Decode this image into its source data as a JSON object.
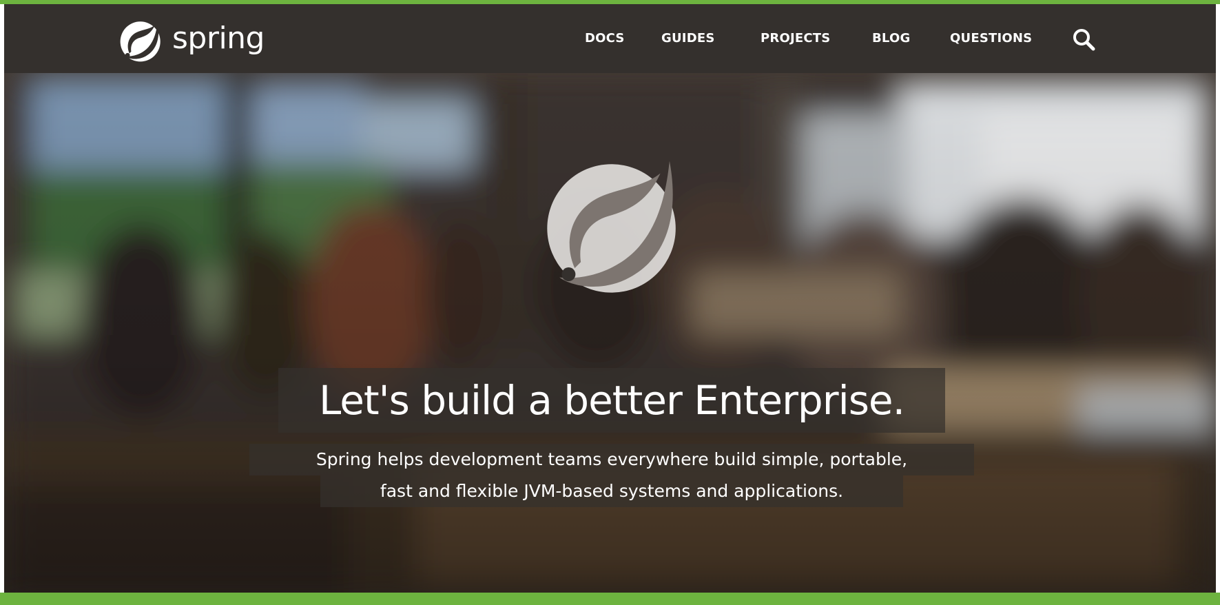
{
  "colors": {
    "brand_green": "#6db33f",
    "navbar_bg": "#34302d",
    "text_light": "#ffffff",
    "leaf_overlay": "#e8e6e4"
  },
  "header": {
    "logo_text": "spring",
    "logo_icon": "spring-leaf-icon",
    "nav": [
      {
        "label": "DOCS"
      },
      {
        "label": "GUIDES"
      },
      {
        "label": "PROJECTS"
      },
      {
        "label": "BLOG"
      },
      {
        "label": "QUESTIONS"
      }
    ],
    "search_icon": "search-icon"
  },
  "hero": {
    "background": "blurred-office-photo",
    "emblem_icon": "spring-leaf-icon",
    "headline": "Let's build a better Enterprise.",
    "subheadline_lines": [
      "Spring helps development teams everywhere build simple, portable,",
      "fast and flexible JVM-based systems and applications."
    ]
  }
}
